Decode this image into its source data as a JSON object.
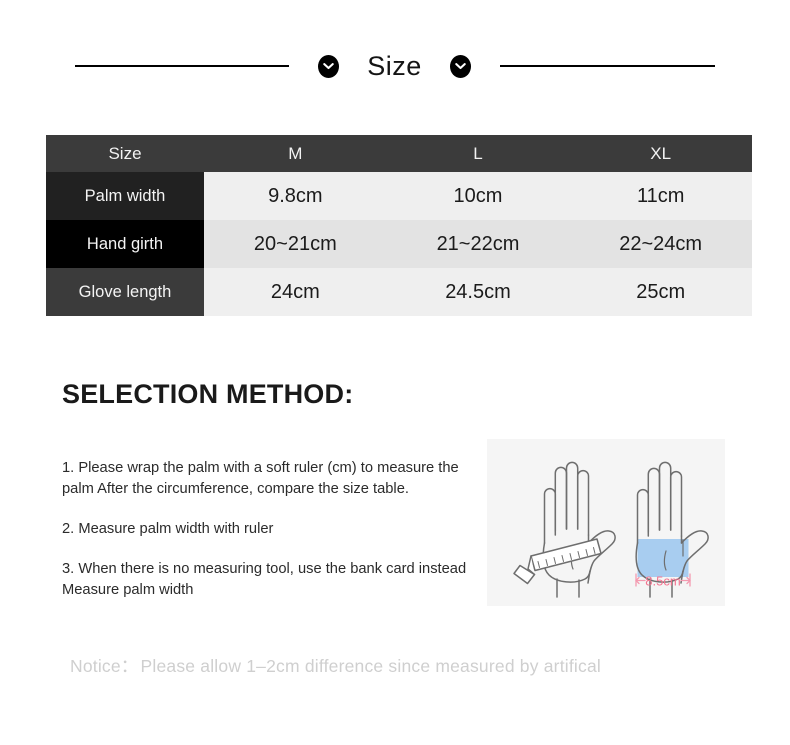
{
  "header": {
    "title": "Size",
    "left_icon": "chevron-down-icon",
    "right_icon": "chevron-down-icon"
  },
  "size_table": {
    "columns": [
      "Size",
      "M",
      "L",
      "XL"
    ],
    "rows": [
      {
        "label": "Palm width",
        "values": [
          "9.8cm",
          "10cm",
          "11cm"
        ]
      },
      {
        "label": "Hand girth",
        "values": [
          "20~21cm",
          "21~22cm",
          "22~24cm"
        ]
      },
      {
        "label": "Glove length",
        "values": [
          "24cm",
          "24.5cm",
          "25cm"
        ]
      }
    ]
  },
  "selection": {
    "title": "SELECTION METHOD:",
    "steps": [
      "1. Please wrap the palm with a soft ruler (cm) to measure the palm After the circumference, compare the size table.",
      "2. Measure palm width with ruler",
      "3. When there is no measuring tool, use the bank card instead Measure palm width"
    ]
  },
  "illustration": {
    "left_caption": "",
    "right_measure_label": "8.5cm",
    "card_color": "#a8cdf0",
    "measure_color": "#f49ab0",
    "outline_color": "#6e6e6e",
    "panel_background": "#f5f5f5"
  },
  "notice": {
    "label": "Notice：",
    "text": "Please allow 1–2cm difference since measured by artifical"
  },
  "colors": {
    "header_row": "#3b3b3b",
    "label_dark": "#212121",
    "label_black": "#000000",
    "cell_light": "#efefef",
    "cell_alt": "#e3e3e3"
  }
}
